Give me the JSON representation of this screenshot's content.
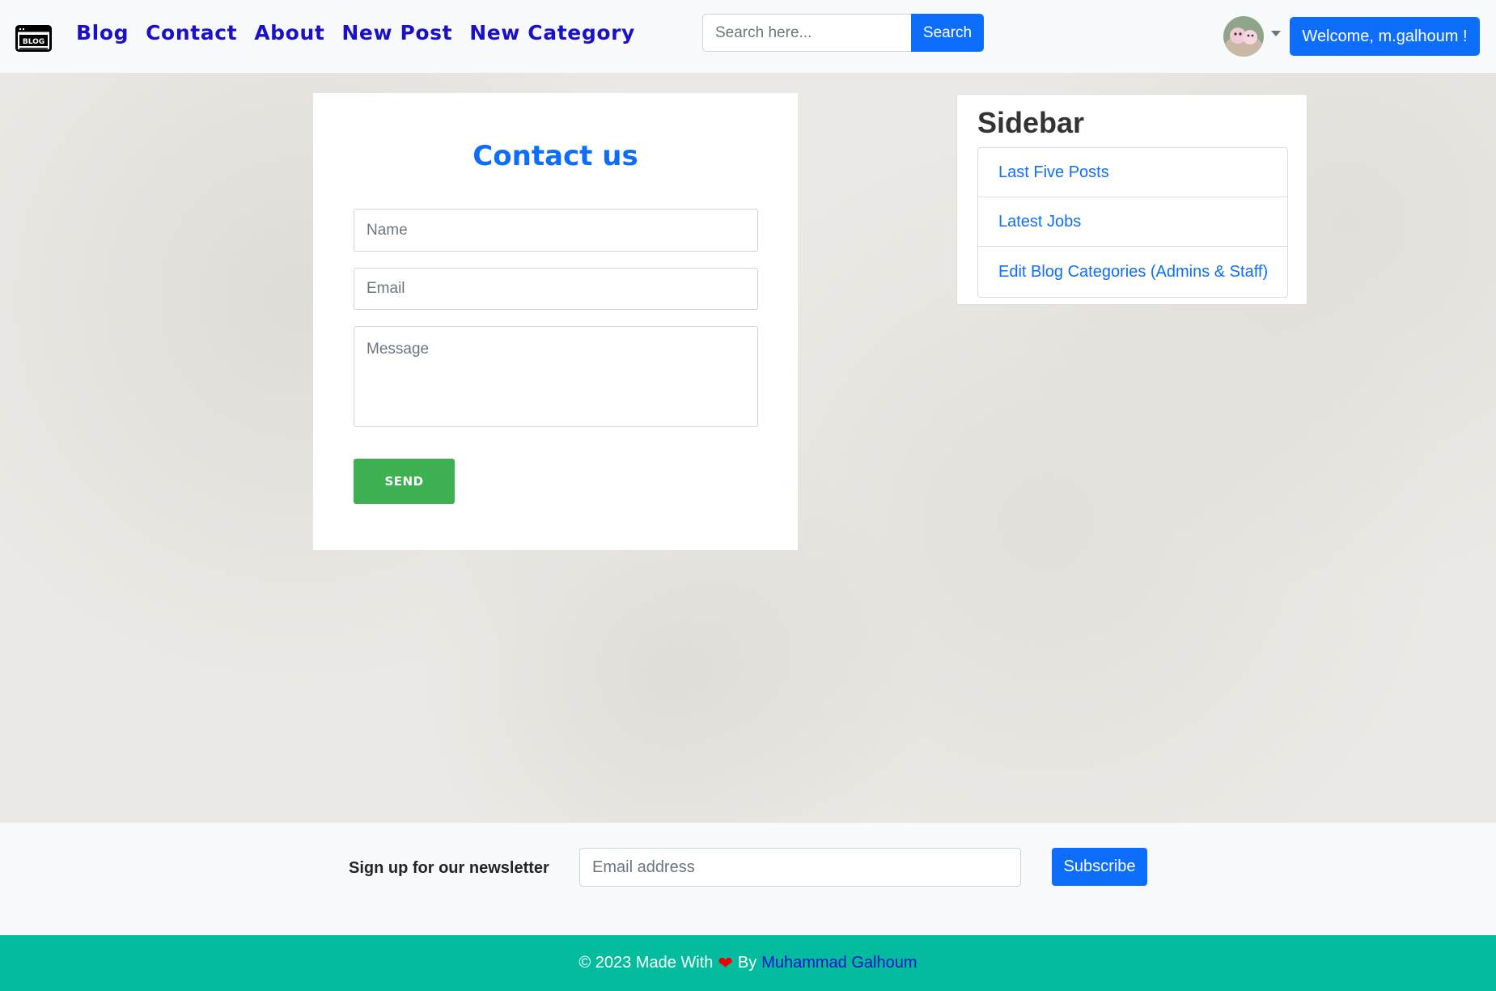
{
  "navbar": {
    "logo_text": "BLOG",
    "links": [
      "Blog",
      "Contact",
      "About",
      "New Post",
      "New Category"
    ],
    "search": {
      "placeholder": "Search here...",
      "button_label": "Search"
    },
    "welcome_label": "Welcome, m.galhoum !"
  },
  "contact": {
    "title": "Contact us",
    "name_placeholder": "Name",
    "email_placeholder": "Email",
    "message_placeholder": "Message",
    "send_label": "SEND"
  },
  "sidebar": {
    "title": "Sidebar",
    "items": [
      {
        "label": "Last Five Posts"
      },
      {
        "label": "Latest Jobs"
      },
      {
        "label": "Edit Blog Categories (Admins & Staff)"
      }
    ]
  },
  "newsletter": {
    "label": "Sign up for our newsletter",
    "placeholder": "Email address",
    "button_label": "Subscribe"
  },
  "footer": {
    "prefix": "© 2023 Made With",
    "by": "By",
    "author": "Muhammad Galhoum"
  },
  "colors": {
    "primary": "#0d6efd",
    "nav_link": "#1a10cc",
    "send_green": "#3db052",
    "footer_teal": "#03bc9e",
    "heart_red": "#ee0000"
  }
}
